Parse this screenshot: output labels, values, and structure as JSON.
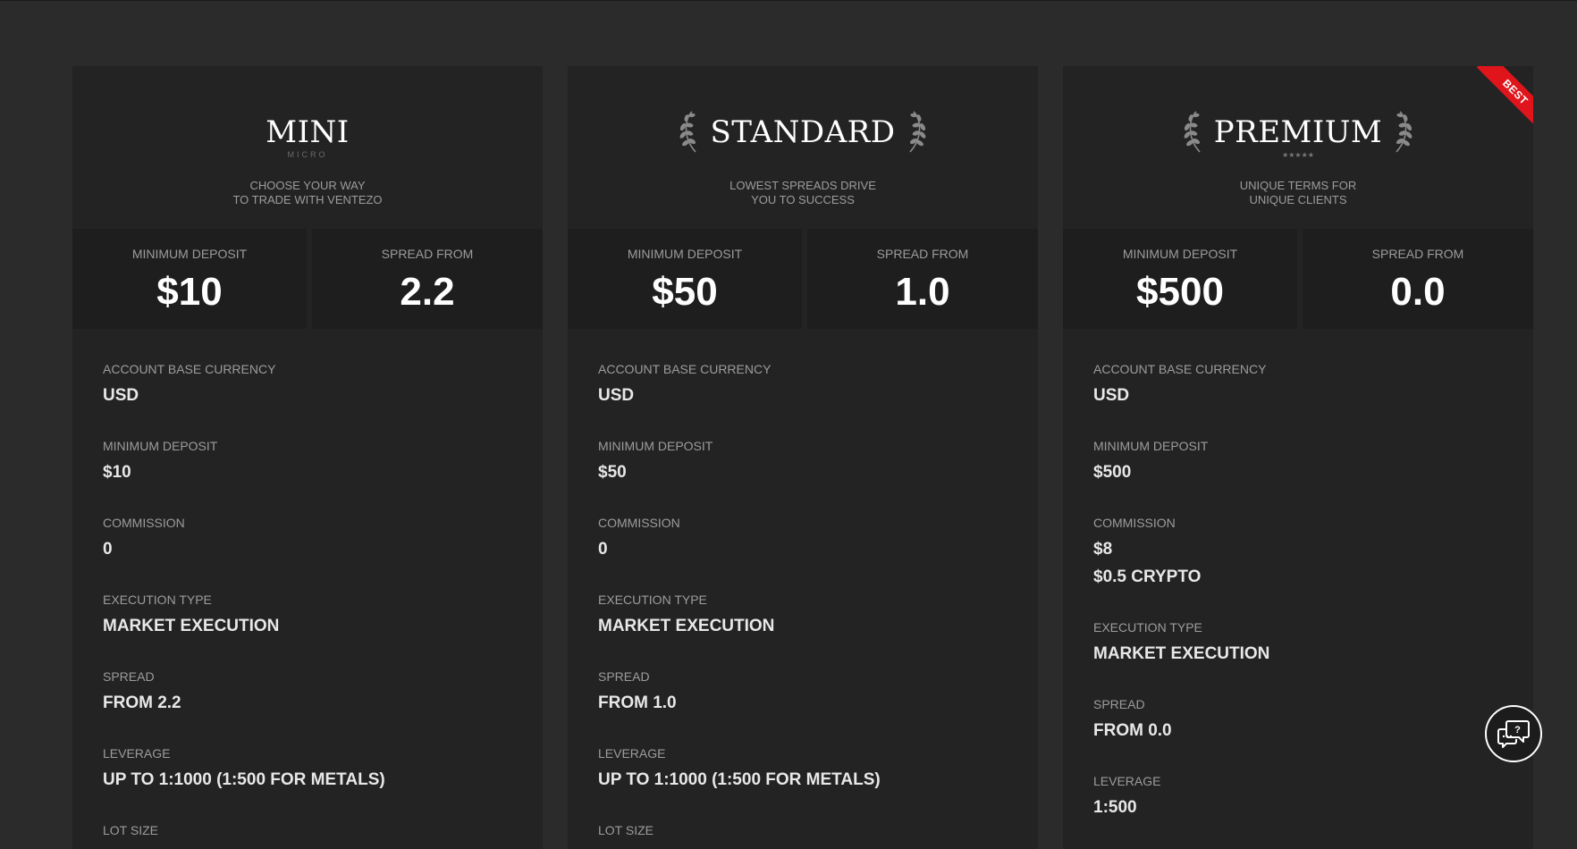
{
  "colors": {
    "background": "#2b2b2b",
    "card": "#232323",
    "stat_block": "#1e1e1e",
    "label": "#9c9c9c",
    "ribbon": "#e0151c"
  },
  "cards": [
    {
      "title": "MINI",
      "subtitle": "MICRO",
      "tagline_line1": "CHOOSE YOUR WAY",
      "tagline_line2": "TO TRADE WITH VENTEZO",
      "stats": [
        {
          "label": "MINIMUM DEPOSIT",
          "value": "$10"
        },
        {
          "label": "SPREAD FROM",
          "value": "2.2"
        }
      ],
      "details": [
        {
          "label": "ACCOUNT BASE CURRENCY",
          "value": "USD"
        },
        {
          "label": "MINIMUM DEPOSIT",
          "value": "$10"
        },
        {
          "label": "COMMISSION",
          "value": "0"
        },
        {
          "label": "EXECUTION TYPE",
          "value": "MARKET EXECUTION"
        },
        {
          "label": "SPREAD",
          "value": "FROM 2.2"
        },
        {
          "label": "LEVERAGE",
          "value": "UP TO 1:1000 (1:500 FOR METALS)"
        },
        {
          "label": "LOT SIZE",
          "value": ""
        }
      ]
    },
    {
      "title": "STANDARD",
      "subtitle": "",
      "tagline_line1": "LOWEST SPREADS DRIVE",
      "tagline_line2": "YOU TO SUCCESS",
      "laurels": true,
      "stats": [
        {
          "label": "MINIMUM DEPOSIT",
          "value": "$50"
        },
        {
          "label": "SPREAD FROM",
          "value": "1.0"
        }
      ],
      "details": [
        {
          "label": "ACCOUNT BASE CURRENCY",
          "value": "USD"
        },
        {
          "label": "MINIMUM DEPOSIT",
          "value": "$50"
        },
        {
          "label": "COMMISSION",
          "value": "0"
        },
        {
          "label": "EXECUTION TYPE",
          "value": "MARKET EXECUTION"
        },
        {
          "label": "SPREAD",
          "value": "FROM 1.0"
        },
        {
          "label": "LEVERAGE",
          "value": "UP TO 1:1000 (1:500 FOR METALS)"
        },
        {
          "label": "LOT SIZE",
          "value": ""
        }
      ]
    },
    {
      "title": "PREMIUM",
      "subtitle": "★★★★★",
      "tagline_line1": "UNIQUE TERMS FOR",
      "tagline_line2": "UNIQUE CLIENTS",
      "laurels": true,
      "ribbon": "BEST",
      "stats": [
        {
          "label": "MINIMUM DEPOSIT",
          "value": "$500"
        },
        {
          "label": "SPREAD FROM",
          "value": "0.0"
        }
      ],
      "details": [
        {
          "label": "ACCOUNT BASE CURRENCY",
          "value": "USD"
        },
        {
          "label": "MINIMUM DEPOSIT",
          "value": "$500"
        },
        {
          "label": "COMMISSION",
          "value": "$8",
          "value2": "$0.5 CRYPTO"
        },
        {
          "label": "EXECUTION TYPE",
          "value": "MARKET EXECUTION"
        },
        {
          "label": "SPREAD",
          "value": "FROM 0.0"
        },
        {
          "label": "LEVERAGE",
          "value": "1:500"
        }
      ]
    }
  ],
  "chat_button": {
    "icon": "chat-help-icon"
  }
}
